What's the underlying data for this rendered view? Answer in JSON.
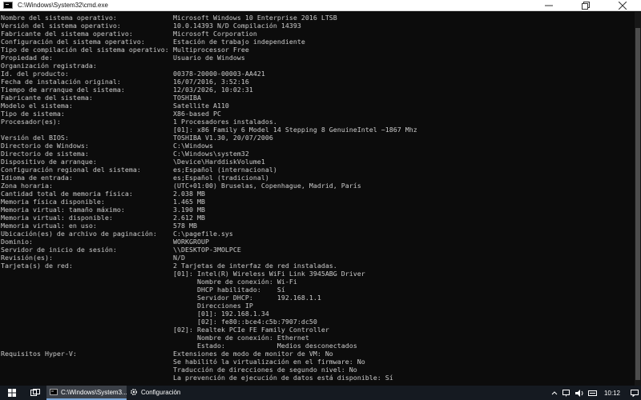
{
  "window": {
    "title": "C:\\Windows\\System32\\cmd.exe"
  },
  "console": {
    "lines": [
      [
        "Nombre del sistema operativo:",
        "Microsoft Windows 10 Enterprise 2016 LTSB"
      ],
      [
        "Versión del sistema operativo:",
        "10.0.14393 N/D Compilación 14393"
      ],
      [
        "Fabricante del sistema operativo:",
        "Microsoft Corporation"
      ],
      [
        "Configuración del sistema operativo:",
        "Estación de trabajo independiente"
      ],
      [
        "Tipo de compilación del sistema operativo:",
        "Multiprocessor Free"
      ],
      [
        "Propiedad de:",
        "Usuario de Windows"
      ],
      [
        "Organización registrada:",
        ""
      ],
      [
        "Id. del producto:",
        "00378-20000-00003-AA421"
      ],
      [
        "Fecha de instalación original:",
        "16/07/2016, 3:52:16"
      ],
      [
        "Tiempo de arranque del sistema:",
        "12/03/2026, 10:02:31"
      ],
      [
        "Fabricante del sistema:",
        "TOSHIBA"
      ],
      [
        "Modelo el sistema:",
        "Satellite A110"
      ],
      [
        "Tipo de sistema:",
        "X86-based PC"
      ],
      [
        "Procesador(es):",
        "1 Procesadores instalados."
      ],
      [
        "",
        "[01]: x86 Family 6 Model 14 Stepping 8 GenuineIntel ~1867 Mhz"
      ],
      [
        "Versión del BIOS:",
        "TOSHIBA V1.30, 20/07/2006"
      ],
      [
        "Directorio de Windows:",
        "C:\\Windows"
      ],
      [
        "Directorio de sistema:",
        "C:\\Windows\\system32"
      ],
      [
        "Dispositivo de arranque:",
        "\\Device\\HarddiskVolume1"
      ],
      [
        "Configuración regional del sistema:",
        "es;Español (internacional)"
      ],
      [
        "Idioma de entrada:",
        "es;Español (tradicional)"
      ],
      [
        "Zona horaria:",
        "(UTC+01:00) Bruselas, Copenhague, Madrid, París"
      ],
      [
        "Cantidad total de memoria física:",
        "2.038 MB"
      ],
      [
        "Memoria física disponible:",
        "1.465 MB"
      ],
      [
        "Memoria virtual: tamaño máximo:",
        "3.190 MB"
      ],
      [
        "Memoria virtual: disponible:",
        "2.612 MB"
      ],
      [
        "Memoria virtual: en uso:",
        "578 MB"
      ],
      [
        "Ubicación(es) de archivo de paginación:",
        "C:\\pagefile.sys"
      ],
      [
        "Dominio:",
        "WORKGROUP"
      ],
      [
        "Servidor de inicio de sesión:",
        "\\\\DESKTOP-3MOLPCE"
      ],
      [
        "Revisión(es):",
        "N/D"
      ],
      [
        "Tarjeta(s) de red:",
        "2 Tarjetas de interfaz de red instaladas."
      ],
      [
        "",
        "[01]: Intel(R) Wireless WiFi Link 3945ABG Driver"
      ],
      [
        "",
        "      Nombre de conexión: Wi-Fi"
      ],
      [
        "",
        "      DHCP habilitado:    Sí"
      ],
      [
        "",
        "      Servidor DHCP:      192.168.1.1"
      ],
      [
        "",
        "      Direcciones IP"
      ],
      [
        "",
        "      [01]: 192.168.1.34"
      ],
      [
        "",
        "      [02]: fe80::bce4:c5b:7907:dc50"
      ],
      [
        "",
        "[02]: Realtek PCIe FE Family Controller"
      ],
      [
        "",
        "      Nombre de conexión: Ethernet"
      ],
      [
        "",
        "      Estado:             Medios desconectados"
      ],
      [
        "Requisitos Hyper-V:",
        "Extensiones de modo de monitor de VM: No"
      ],
      [
        "",
        "Se habilitó la virtualización en el firmware: No"
      ],
      [
        "",
        "Traducción de direcciones de segundo nivel: No"
      ],
      [
        "",
        "La prevención de ejecución de datos está disponible: Sí"
      ]
    ]
  },
  "taskbar": {
    "tasks": [
      {
        "label": "C:\\Windows\\System3...",
        "active": true
      },
      {
        "label": "Configuración",
        "active": false
      }
    ],
    "clock": "10:12"
  },
  "colors": {
    "console_bg": "#0c0c0c",
    "console_text": "#cccccc",
    "taskbar_bg": "#151a21",
    "accent": "#7aa7d9"
  },
  "icons": {
    "start": "windows-logo-icon",
    "task_view": "task-view-icon",
    "tray": [
      "chevron-up-icon",
      "network-icon",
      "speaker-icon",
      "language-icon",
      "notification-icon"
    ]
  }
}
